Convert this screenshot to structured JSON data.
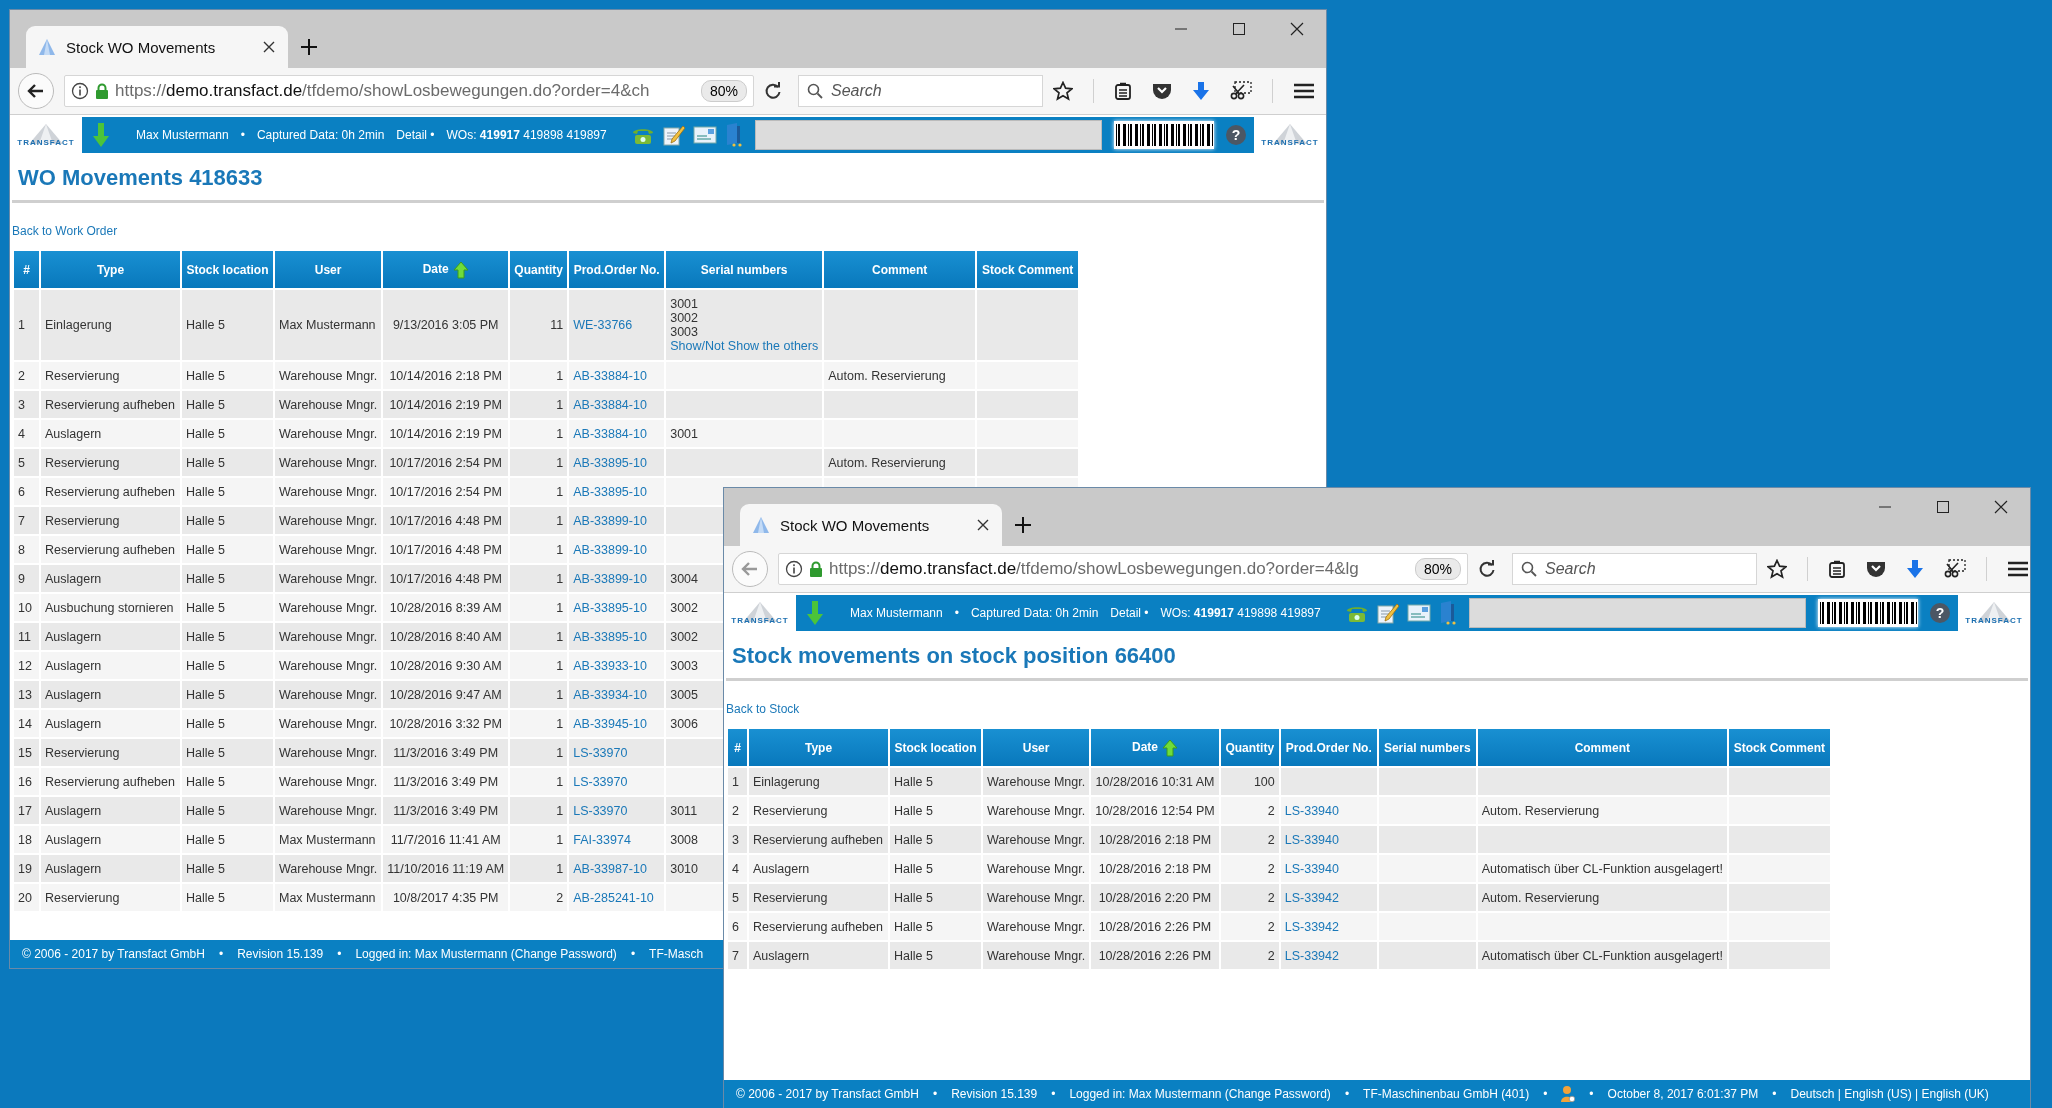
{
  "desktop": {
    "windows": [
      {
        "tab": {
          "title": "Stock WO Movements"
        },
        "address_bar": {
          "scheme": "https://",
          "host": "demo.transfact.de",
          "path": "/tfdemo/showLosbewegungen.do?order=4&ch",
          "zoom": "80%"
        },
        "search": {
          "placeholder": "Search"
        },
        "app_header": {
          "logo_left": "TRANSFACT",
          "logo_right": "TRANSFACT",
          "items": [
            "Max Mustermann",
            "•",
            "Captured Data: 0h 2min",
            "Detail •",
            "WOs:  **419917** 419898 419897"
          ],
          "help": "?"
        },
        "title": "WO Movements 418633",
        "back_link": "Back to Work Order",
        "table": {
          "columns": [
            {
              "label": "#",
              "sorted": false
            },
            {
              "label": "Type",
              "sorted": false
            },
            {
              "label": "Stock location",
              "sorted": false
            },
            {
              "label": "User",
              "sorted": false
            },
            {
              "label": "Date",
              "sorted": true
            },
            {
              "label": "Quantity",
              "sorted": false
            },
            {
              "label": "Prod.Order No.",
              "sorted": false
            },
            {
              "label": "Serial numbers",
              "sorted": false
            },
            {
              "label": "Comment",
              "sorted": false
            },
            {
              "label": "Stock Comment",
              "sorted": false
            }
          ],
          "rows": [
            {
              "number": "1",
              "type": "Einlagerung",
              "location": "Halle 5",
              "user": "Max Mustermann",
              "date": "9/13/2016 3:05 PM",
              "quantity": "11",
              "order": "WE-33766",
              "serials": [
                "3001",
                "3002",
                "3003"
              ],
              "serials_toggle": "Show/Not Show the others"
            },
            {
              "number": "2",
              "type": "Reservierung",
              "location": "Halle 5",
              "user": "Warehouse Mngr.",
              "date": "10/14/2016 2:18 PM",
              "quantity": "1",
              "order": "AB-33884-10",
              "comment": "Autom. Reservierung"
            },
            {
              "number": "3",
              "type": "Reservierung aufheben",
              "location": "Halle 5",
              "user": "Warehouse Mngr.",
              "date": "10/14/2016 2:19 PM",
              "quantity": "1",
              "order": "AB-33884-10"
            },
            {
              "number": "4",
              "type": "Auslagern",
              "location": "Halle 5",
              "user": "Warehouse Mngr.",
              "date": "10/14/2016 2:19 PM",
              "quantity": "1",
              "order": "AB-33884-10",
              "serials": [
                "3001"
              ]
            },
            {
              "number": "5",
              "type": "Reservierung",
              "location": "Halle 5",
              "user": "Warehouse Mngr.",
              "date": "10/17/2016 2:54 PM",
              "quantity": "1",
              "order": "AB-33895-10",
              "comment": "Autom. Reservierung"
            },
            {
              "number": "6",
              "type": "Reservierung aufheben",
              "location": "Halle 5",
              "user": "Warehouse Mngr.",
              "date": "10/17/2016 2:54 PM",
              "quantity": "1",
              "order": "AB-33895-10"
            },
            {
              "number": "7",
              "type": "Reservierung",
              "location": "Halle 5",
              "user": "Warehouse Mngr.",
              "date": "10/17/2016 4:48 PM",
              "quantity": "1",
              "order": "AB-33899-10"
            },
            {
              "number": "8",
              "type": "Reservierung aufheben",
              "location": "Halle 5",
              "user": "Warehouse Mngr.",
              "date": "10/17/2016 4:48 PM",
              "quantity": "1",
              "order": "AB-33899-10"
            },
            {
              "number": "9",
              "type": "Auslagern",
              "location": "Halle 5",
              "user": "Warehouse Mngr.",
              "date": "10/17/2016 4:48 PM",
              "quantity": "1",
              "order": "AB-33899-10",
              "serials": [
                "3004"
              ]
            },
            {
              "number": "10",
              "type": "Ausbuchung stornieren",
              "location": "Halle 5",
              "user": "Warehouse Mngr.",
              "date": "10/28/2016 8:39 AM",
              "quantity": "1",
              "order": "AB-33895-10",
              "serials": [
                "3002"
              ]
            },
            {
              "number": "11",
              "type": "Auslagern",
              "location": "Halle 5",
              "user": "Warehouse Mngr.",
              "date": "10/28/2016 8:40 AM",
              "quantity": "1",
              "order": "AB-33895-10",
              "serials": [
                "3002"
              ]
            },
            {
              "number": "12",
              "type": "Auslagern",
              "location": "Halle 5",
              "user": "Warehouse Mngr.",
              "date": "10/28/2016 9:30 AM",
              "quantity": "1",
              "order": "AB-33933-10",
              "serials": [
                "3003"
              ]
            },
            {
              "number": "13",
              "type": "Auslagern",
              "location": "Halle 5",
              "user": "Warehouse Mngr.",
              "date": "10/28/2016 9:47 AM",
              "quantity": "1",
              "order": "AB-33934-10",
              "serials": [
                "3005"
              ]
            },
            {
              "number": "14",
              "type": "Auslagern",
              "location": "Halle 5",
              "user": "Warehouse Mngr.",
              "date": "10/28/2016 3:32 PM",
              "quantity": "1",
              "order": "AB-33945-10",
              "serials": [
                "3006"
              ]
            },
            {
              "number": "15",
              "type": "Reservierung",
              "location": "Halle 5",
              "user": "Warehouse Mngr.",
              "date": "11/3/2016 3:49 PM",
              "quantity": "1",
              "order": "LS-33970"
            },
            {
              "number": "16",
              "type": "Reservierung aufheben",
              "location": "Halle 5",
              "user": "Warehouse Mngr.",
              "date": "11/3/2016 3:49 PM",
              "quantity": "1",
              "order": "LS-33970"
            },
            {
              "number": "17",
              "type": "Auslagern",
              "location": "Halle 5",
              "user": "Warehouse Mngr.",
              "date": "11/3/2016 3:49 PM",
              "quantity": "1",
              "order": "LS-33970",
              "serials": [
                "3011"
              ]
            },
            {
              "number": "18",
              "type": "Auslagern",
              "location": "Halle 5",
              "user": "Max Mustermann",
              "date": "11/7/2016 11:41 AM",
              "quantity": "1",
              "order": "FAI-33974",
              "serials": [
                "3008"
              ]
            },
            {
              "number": "19",
              "type": "Auslagern",
              "location": "Halle 5",
              "user": "Warehouse Mngr.",
              "date": "11/10/2016 11:19 AM",
              "quantity": "1",
              "order": "AB-33987-10",
              "serials": [
                "3010"
              ]
            },
            {
              "number": "20",
              "type": "Reservierung",
              "location": "Halle 5",
              "user": "Max Mustermann",
              "date": "10/8/2017 4:35 PM",
              "quantity": "2",
              "order": "AB-285241-10"
            }
          ]
        },
        "footer": {
          "separator": "•",
          "items": [
            {
              "kind": "text",
              "text": "© 2006 - 2017 by Transfact GmbH"
            },
            {
              "kind": "text",
              "text": "Revision  15.139"
            },
            {
              "kind": "text",
              "text": "Logged in: Max Mustermann (Change Password)"
            },
            {
              "kind": "text",
              "text": "TF-Masch"
            }
          ]
        }
      },
      {
        "tab": {
          "title": "Stock WO Movements"
        },
        "address_bar": {
          "scheme": "https://",
          "host": "demo.transfact.de",
          "path": "/tfdemo/showLosbewegungen.do?order=4&lg",
          "zoom": "80%"
        },
        "search": {
          "placeholder": "Search"
        },
        "app_header": {
          "logo_left": "TRANSFACT",
          "logo_right": "TRANSFACT",
          "items": [
            "Max Mustermann",
            "•",
            "Captured Data: 0h 2min",
            "Detail •",
            "WOs:  **419917** 419898 419897"
          ],
          "help": "?"
        },
        "title": "Stock movements on stock position 66400",
        "back_link": "Back to Stock",
        "table": {
          "columns": [
            {
              "label": "#",
              "sorted": false
            },
            {
              "label": "Type",
              "sorted": false
            },
            {
              "label": "Stock location",
              "sorted": false
            },
            {
              "label": "User",
              "sorted": false
            },
            {
              "label": "Date",
              "sorted": true
            },
            {
              "label": "Quantity",
              "sorted": false
            },
            {
              "label": "Prod.Order No.",
              "sorted": false
            },
            {
              "label": "Serial numbers",
              "sorted": false
            },
            {
              "label": "Comment",
              "sorted": false
            },
            {
              "label": "Stock Comment",
              "sorted": false
            }
          ],
          "rows": [
            {
              "number": "1",
              "type": "Einlagerung",
              "location": "Halle 5",
              "user": "Warehouse Mngr.",
              "date": "10/28/2016 10:31 AM",
              "quantity": "100"
            },
            {
              "number": "2",
              "type": "Reservierung",
              "location": "Halle 5",
              "user": "Warehouse Mngr.",
              "date": "10/28/2016 12:54 PM",
              "quantity": "2",
              "order": "LS-33940",
              "comment": "Autom. Reservierung"
            },
            {
              "number": "3",
              "type": "Reservierung aufheben",
              "location": "Halle 5",
              "user": "Warehouse Mngr.",
              "date": "10/28/2016 2:18 PM",
              "quantity": "2",
              "order": "LS-33940"
            },
            {
              "number": "4",
              "type": "Auslagern",
              "location": "Halle 5",
              "user": "Warehouse Mngr.",
              "date": "10/28/2016 2:18 PM",
              "quantity": "2",
              "order": "LS-33940",
              "comment": "Automatisch über CL-Funktion ausgelagert!"
            },
            {
              "number": "5",
              "type": "Reservierung",
              "location": "Halle 5",
              "user": "Warehouse Mngr.",
              "date": "10/28/2016 2:20 PM",
              "quantity": "2",
              "order": "LS-33942",
              "comment": "Autom. Reservierung"
            },
            {
              "number": "6",
              "type": "Reservierung aufheben",
              "location": "Halle 5",
              "user": "Warehouse Mngr.",
              "date": "10/28/2016 2:26 PM",
              "quantity": "2",
              "order": "LS-33942"
            },
            {
              "number": "7",
              "type": "Auslagern",
              "location": "Halle 5",
              "user": "Warehouse Mngr.",
              "date": "10/28/2016 2:26 PM",
              "quantity": "2",
              "order": "LS-33942",
              "comment": "Automatisch über CL-Funktion ausgelagert!"
            }
          ]
        },
        "footer": {
          "separator": "•",
          "items": [
            {
              "kind": "text",
              "text": "© 2006 - 2017 by Transfact GmbH"
            },
            {
              "kind": "text",
              "text": "Revision  15.139"
            },
            {
              "kind": "text",
              "text": "Logged in: Max Mustermann (Change Password)"
            },
            {
              "kind": "text",
              "text": "TF-Maschinenbau GmbH (401)"
            },
            {
              "kind": "icon"
            },
            {
              "kind": "text",
              "text": "October 8, 2017 6:01:37 PM"
            },
            {
              "kind": "text",
              "text": "Deutsch | English (US) | English (UK)"
            }
          ]
        }
      }
    ]
  }
}
